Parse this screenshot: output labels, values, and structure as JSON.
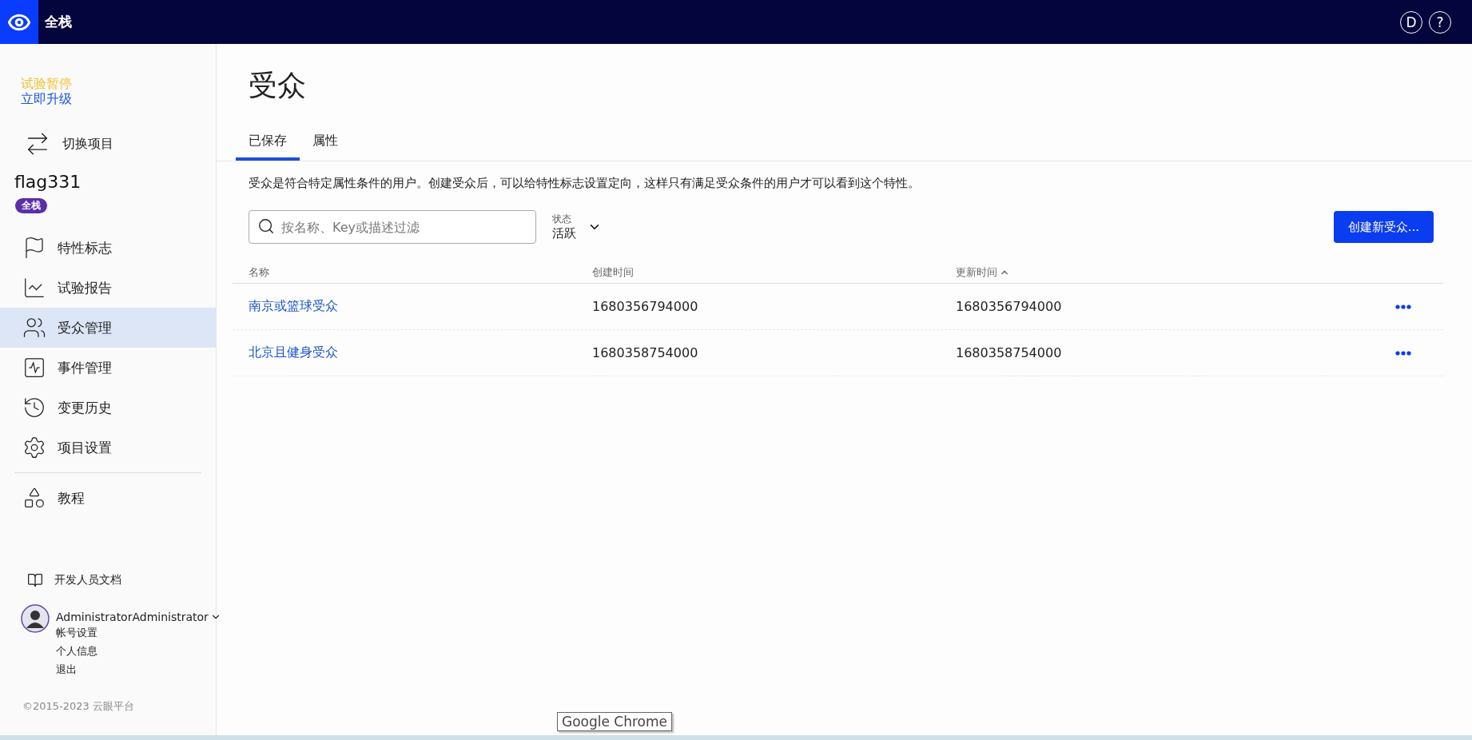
{
  "top_bar": {
    "brand": "全栈",
    "buttons": [
      "D",
      "?"
    ]
  },
  "sidebar": {
    "trial_status": "试验暂停",
    "upgrade_link": "立即升级",
    "switch_project": "切换项目",
    "project": {
      "name": "flag331",
      "badge": "全栈"
    },
    "nav": [
      {
        "label": "特性标志",
        "selected": false
      },
      {
        "label": "试验报告",
        "selected": false
      },
      {
        "label": "受众管理",
        "selected": true
      },
      {
        "label": "事件管理",
        "selected": false
      },
      {
        "label": "变更历史",
        "selected": false
      },
      {
        "label": "项目设置",
        "selected": false
      }
    ],
    "secondary_nav": [
      {
        "label": "教程",
        "selected": false
      }
    ],
    "docs_link": "开发人员文档",
    "user": {
      "name": "AdministratorAdministrator",
      "menu": [
        "帐号设置",
        "个人信息",
        "退出"
      ]
    },
    "copyright": "©2015-2023 云眼平台"
  },
  "page": {
    "title": "受众",
    "tabs": [
      {
        "label": "已保存",
        "selected": true
      },
      {
        "label": "属性",
        "selected": false
      }
    ],
    "description": "受众是符合特定属性条件的用户。创建受众后，可以给特性标志设置定向，这样只有满足受众条件的用户才可以看到这个特性。",
    "search": {
      "placeholder": "按名称、Key或描述过滤"
    },
    "status_filter": {
      "label": "状态",
      "value": "活跃"
    },
    "create_button": "创建新受众...",
    "table": {
      "columns": [
        {
          "label": "名称",
          "sorted": false
        },
        {
          "label": "创建时间",
          "sorted": false
        },
        {
          "label": "更新时间",
          "sorted": true
        }
      ],
      "rows": [
        {
          "name": "南京或篮球受众",
          "created": "1680356794000",
          "updated": "1680356794000"
        },
        {
          "name": "北京且健身受众",
          "created": "1680358754000",
          "updated": "1680358754000"
        }
      ]
    }
  },
  "tooltip": "Google Chrome"
}
